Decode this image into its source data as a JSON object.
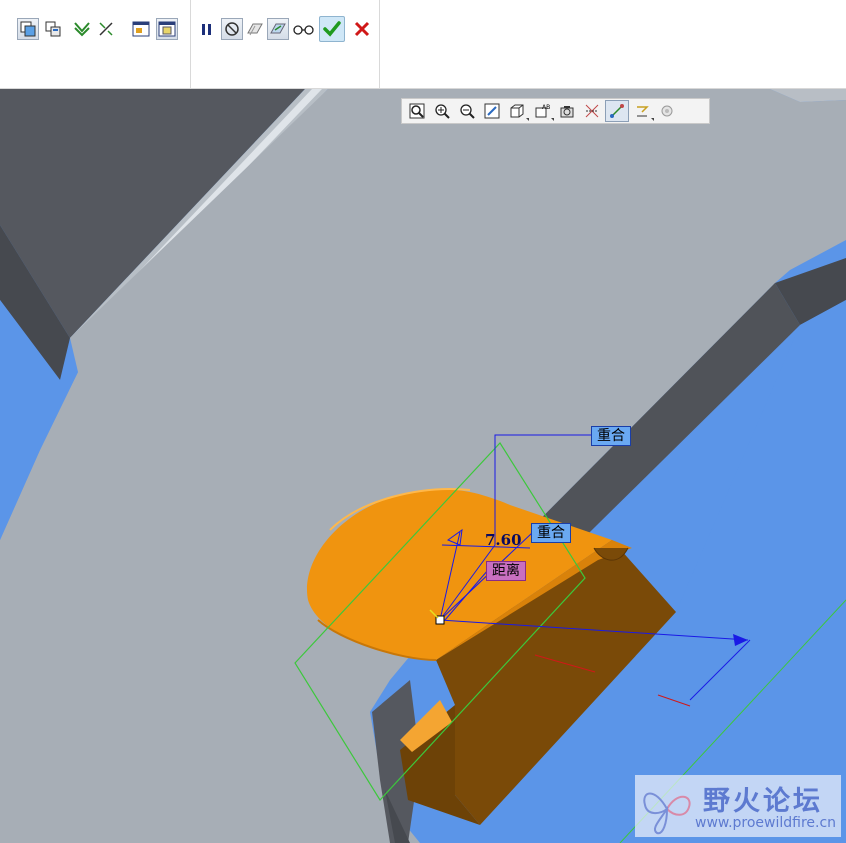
{
  "dashboard": {
    "group1_icons": [
      "pick-placement-icon",
      "component-window-icon",
      "constraint-icon",
      "move-icon",
      "separate-window-icon",
      "main-window-icon"
    ],
    "group2_icons": [
      "pause-icon",
      "no-constraint-icon",
      "offset-icon",
      "preview-icon",
      "glasses-icon",
      "accept-icon",
      "cancel-icon"
    ]
  },
  "view_toolbar": {
    "icons": [
      "refit-icon",
      "zoom-in-icon",
      "zoom-out-icon",
      "repaint-icon",
      "display-style-icon",
      "saved-views-icon",
      "layers-icon",
      "datum-display-icon",
      "axis-display-icon",
      "point-display-icon",
      "csys-display-icon",
      "spin-center-icon"
    ]
  },
  "annotations": {
    "tag_coincident_1": "重合",
    "tag_coincident_2": "重合",
    "tag_distance": "距离",
    "dimension_value": "7.60"
  },
  "watermark": {
    "title": "野火论坛",
    "url": "www.proewildfire.cn"
  },
  "colors": {
    "background": "#5b95e8",
    "base_part_top": "#a6adb5",
    "base_part_side": "#4f5259",
    "component_top": "#f0940f",
    "component_side": "#7a4a08",
    "constraint_blue": "#1a1ae6",
    "constraint_green": "#3cc83c"
  }
}
